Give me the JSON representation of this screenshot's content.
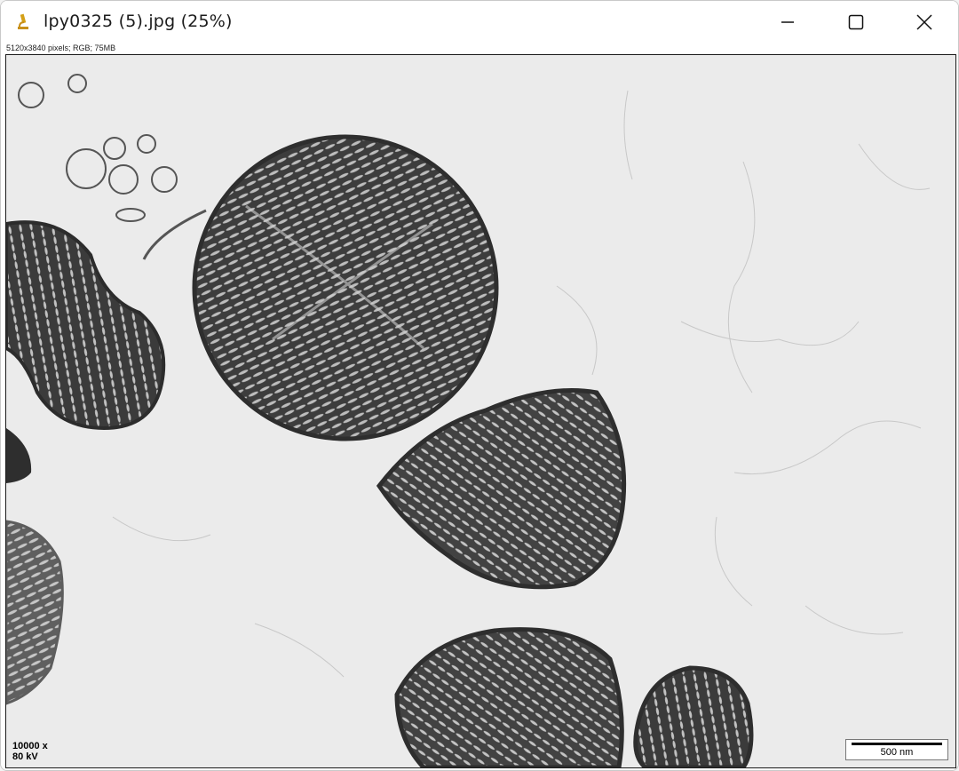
{
  "window": {
    "title": "lpy0325 (5).jpg (25%)",
    "icon": "microscope-icon",
    "controls": {
      "minimize": "minimize-icon",
      "maximize": "maximize-icon",
      "close": "close-icon"
    }
  },
  "image": {
    "info": "5120x3840 pixels; RGB; 75MB",
    "magnification": "10000 x",
    "voltage": "80 kV",
    "scale_bar_label": "500 nm"
  },
  "colors": {
    "background": "#ebebeb",
    "organelle": "#3a3a3a"
  }
}
